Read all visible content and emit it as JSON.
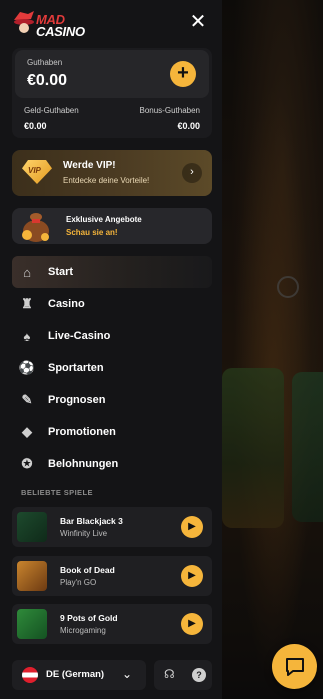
{
  "brand": {
    "line1": "MAD",
    "line2": "CASINO",
    "accent": "#e23b3b"
  },
  "close": {
    "icon": "close-icon",
    "glyph": "✕"
  },
  "wallet": {
    "label": "Guthaben",
    "amount": "€0.00",
    "add_glyph": "+",
    "cash_label": "Geld-Guthaben",
    "cash_value": "€0.00",
    "bonus_label": "Bonus-Guthaben",
    "bonus_value": "€0.00"
  },
  "vip": {
    "badge": "VIP",
    "title": "Werde VIP!",
    "subtitle": "Entdecke deine Vorteile!",
    "arrow": "›"
  },
  "offers": {
    "title": "Exklusive Angebote",
    "subtitle": "Schau sie an!"
  },
  "nav": {
    "items": [
      {
        "label": "Start",
        "icon": "home-icon",
        "glyph": "⌂"
      },
      {
        "label": "Casino",
        "icon": "slot-machine-icon",
        "glyph": "♜"
      },
      {
        "label": "Live-Casino",
        "icon": "cards-icon",
        "glyph": "♠"
      },
      {
        "label": "Sportarten",
        "icon": "soccer-ball-icon",
        "glyph": "⚽"
      },
      {
        "label": "Prognosen",
        "icon": "prediction-icon",
        "glyph": "✎"
      },
      {
        "label": "Promotionen",
        "icon": "diamond-icon",
        "glyph": "◆"
      },
      {
        "label": "Belohnungen",
        "icon": "reward-icon",
        "glyph": "✪"
      }
    ]
  },
  "popular": {
    "title": "BELIEBTE SPIELE",
    "games": [
      {
        "name": "Bar Blackjack 3",
        "provider": "Winfinity Live",
        "play": "▶"
      },
      {
        "name": "Book of Dead",
        "provider": "Play'n GO",
        "play": "▶"
      },
      {
        "name": "9 Pots of Gold",
        "provider": "Microgaming",
        "play": "▶"
      }
    ]
  },
  "language": {
    "label": "DE (German)",
    "chevron": "⌄"
  },
  "support": {
    "headset_glyph": "☊",
    "help_glyph": "?"
  },
  "colors": {
    "accent": "#f5b53b",
    "panel": "#141416",
    "card": "#1f1f22"
  }
}
